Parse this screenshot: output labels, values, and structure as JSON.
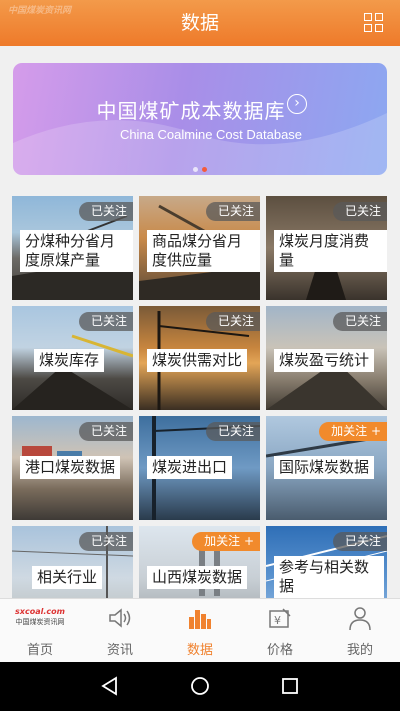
{
  "header": {
    "title": "数据",
    "watermark": "中国煤炭资讯网"
  },
  "banner": {
    "title": "中国煤矿成本数据库",
    "subtitle": "China Coalmine Cost Database",
    "active_dot": 1,
    "dot_count": 2
  },
  "tiles": [
    {
      "label": "分煤种分省月度原煤产量",
      "status": "已关注",
      "followed": true
    },
    {
      "label": "商品煤分省月度供应量",
      "status": "已关注",
      "followed": true
    },
    {
      "label": "煤炭月度消费量",
      "status": "已关注",
      "followed": true
    },
    {
      "label": "煤炭库存",
      "status": "已关注",
      "followed": true
    },
    {
      "label": "煤炭供需对比",
      "status": "已关注",
      "followed": true
    },
    {
      "label": "煤炭盈亏统计",
      "status": "已关注",
      "followed": true
    },
    {
      "label": "港口煤炭数据",
      "status": "已关注",
      "followed": true
    },
    {
      "label": "煤炭进出口",
      "status": "已关注",
      "followed": true
    },
    {
      "label": "国际煤炭数据",
      "status": "加关注 +",
      "followed": false
    },
    {
      "label": "相关行业",
      "status": "已关注",
      "followed": true
    },
    {
      "label": "山西煤炭数据",
      "status": "加关注 +",
      "followed": false
    },
    {
      "label": "参考与相关数据",
      "status": "已关注",
      "followed": true
    }
  ],
  "tabbar": {
    "logo_text": "sxcoal.com",
    "logo_sub": "中国煤炭资讯网",
    "items": [
      {
        "label": "首页",
        "icon": "home-logo-icon"
      },
      {
        "label": "资讯",
        "icon": "speaker-icon"
      },
      {
        "label": "数据",
        "icon": "bar-chart-icon",
        "active": true
      },
      {
        "label": "价格",
        "icon": "price-tag-icon"
      },
      {
        "label": "我的",
        "icon": "person-icon"
      }
    ]
  },
  "colors": {
    "header": "#ef8232",
    "accent": "#f0822f",
    "badge_followed": "#5a5a5a",
    "badge_add": "#f18a2c"
  }
}
